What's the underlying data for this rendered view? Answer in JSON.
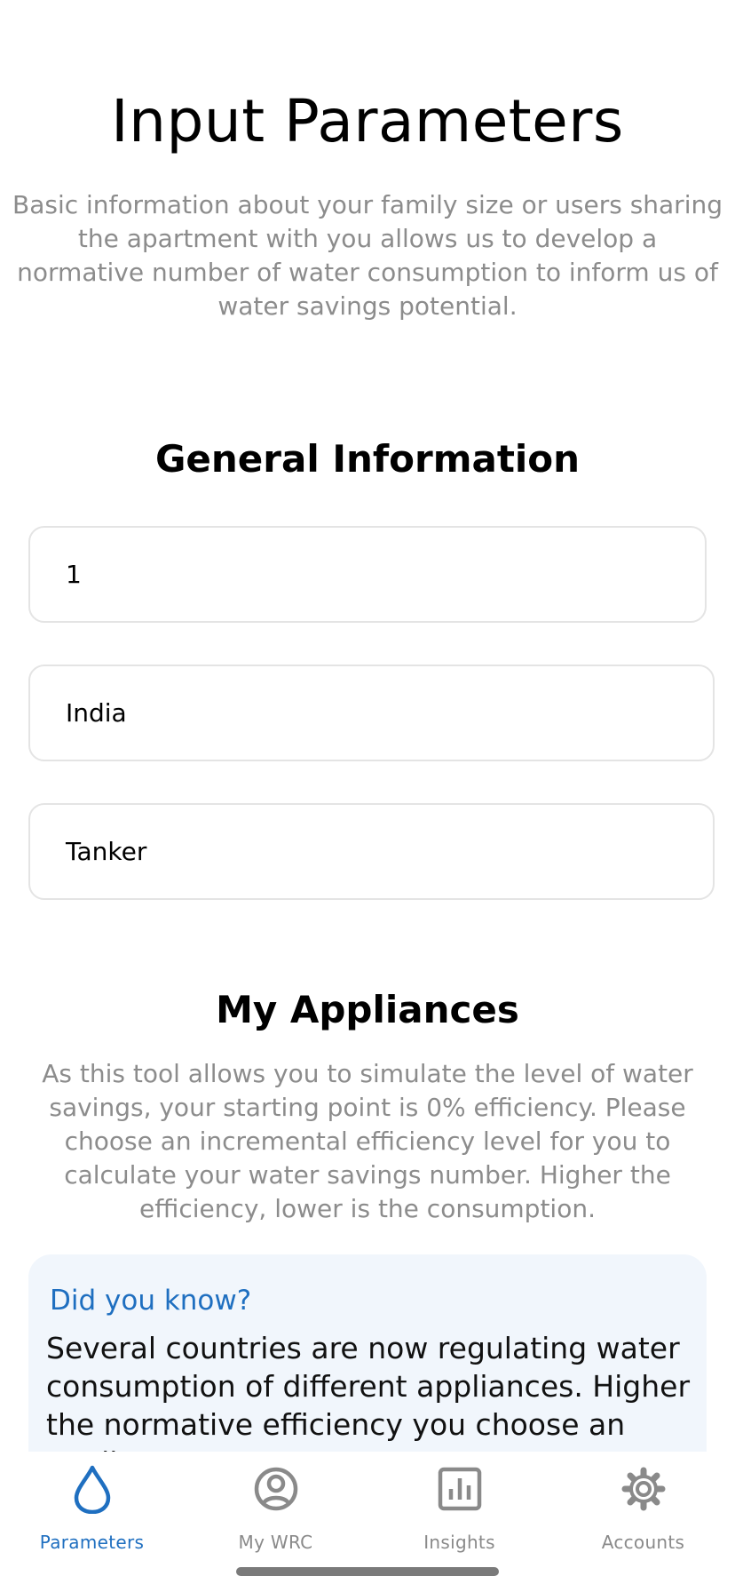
{
  "header": {
    "title": "Input Parameters",
    "intro": "Basic information about your family size or users sharing the apartment with you allows us to develop a normative number of water consumption to inform us of water savings potential."
  },
  "general": {
    "title": "General Information",
    "fields": [
      {
        "value": "1"
      },
      {
        "value": "India"
      },
      {
        "value": "Tanker"
      }
    ]
  },
  "appliances": {
    "title": "My Appliances",
    "description": "As this tool allows you to simulate the level of water savings, your starting point is 0% efficiency. Please choose an incremental efficiency level for you to calculate your water savings number. Higher the efficiency, lower is the consumption.",
    "tip": {
      "title": "Did you know?",
      "body": "Several countries are now regulating water consumption of different appliances. Higher the normative efficiency you choose an appliance"
    }
  },
  "tabs": [
    {
      "label": "Parameters",
      "icon": "water-drop-icon",
      "active": true
    },
    {
      "label": "My WRC",
      "icon": "user-circle-icon",
      "active": false
    },
    {
      "label": "Insights",
      "icon": "bar-chart-icon",
      "active": false
    },
    {
      "label": "Accounts",
      "icon": "gear-icon",
      "active": false
    }
  ],
  "colors": {
    "accent": "#1f6fc0",
    "muted_text": "#8c8c8c",
    "card_bg": "#f1f6fc",
    "field_border": "#e4e4e4"
  }
}
